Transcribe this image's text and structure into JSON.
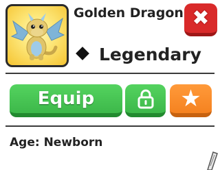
{
  "pet": {
    "name": "Golden Dragon",
    "rarity": "Legendary",
    "age_text": "Age: Newborn"
  },
  "buttons": {
    "equip_label": "Equip",
    "close_symbol": "✖",
    "lock_icon": "lock-icon",
    "favorite_symbol": "★"
  },
  "colors": {
    "close": "#d92a2a",
    "equip": "#45c252",
    "lock": "#45c252",
    "favorite": "#f58220",
    "thumbnail_bg": "#fde77a"
  }
}
